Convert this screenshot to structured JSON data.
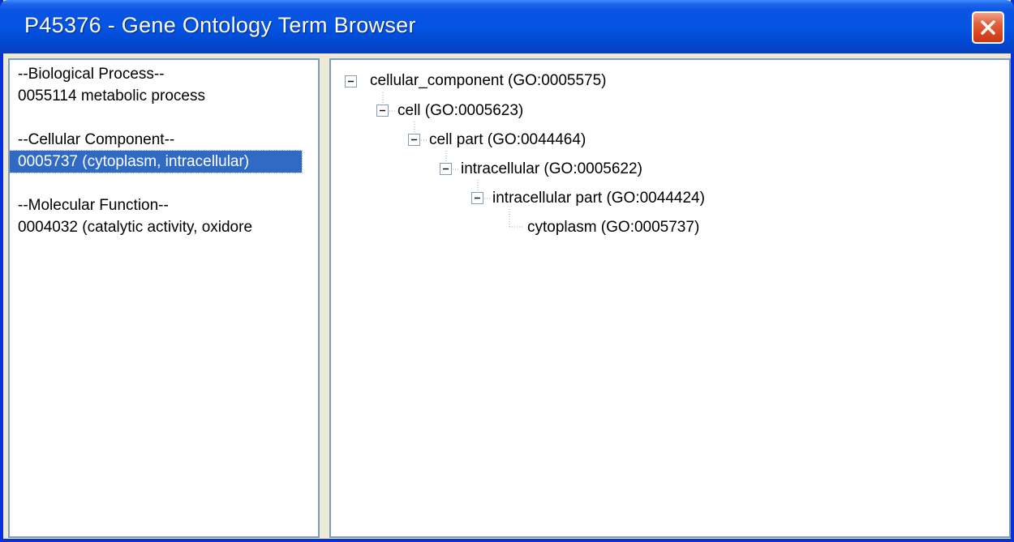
{
  "window": {
    "title": "P45376 - Gene Ontology Term Browser"
  },
  "left_list": {
    "items": [
      {
        "text": "--Biological Process--"
      },
      {
        "text": "0055114 metabolic process"
      },
      {
        "text": "--Cellular Component--"
      },
      {
        "text": "0005737 (cytoplasm, intracellular)",
        "selected": true
      },
      {
        "text": "--Molecular Function--"
      },
      {
        "text": "0004032 (catalytic activity, oxidore"
      }
    ]
  },
  "tree": {
    "nodes": [
      {
        "label": "cellular_component (GO:0005575)",
        "depth": 0,
        "expanded": true
      },
      {
        "label": "cell (GO:0005623)",
        "depth": 1,
        "expanded": true
      },
      {
        "label": "cell part (GO:0044464)",
        "depth": 2,
        "expanded": true
      },
      {
        "label": "intracellular (GO:0005622)",
        "depth": 3,
        "expanded": true
      },
      {
        "label": "intracellular part (GO:0044424)",
        "depth": 4,
        "expanded": true
      },
      {
        "label": "cytoplasm (GO:0005737)",
        "depth": 5,
        "expanded": false,
        "leaf": true
      }
    ]
  },
  "icons": {
    "close": "close-icon",
    "expander": "minus-box-icon"
  },
  "colors": {
    "titlebar": "#0554e3",
    "selection": "#316ac5",
    "close_button": "#d8461f"
  }
}
